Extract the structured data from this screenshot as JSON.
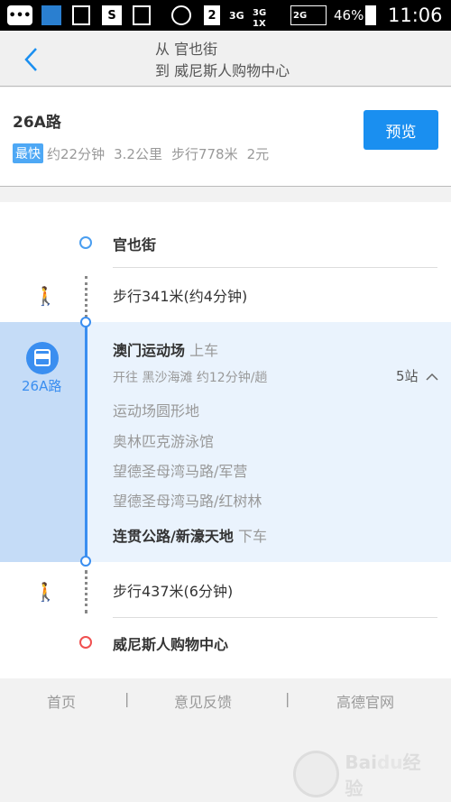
{
  "status_bar": {
    "sim": "2",
    "net1": "3G",
    "net2": "3G",
    "net3": "1X",
    "net4": "2G",
    "battery": "46%",
    "time": "11:06"
  },
  "header": {
    "from_prefix": "从",
    "from": "官也街",
    "to_prefix": "到",
    "to": "威尼斯人购物中心"
  },
  "route": {
    "name": "26A路",
    "badge": "最快",
    "duration": "约22分钟",
    "distance": "3.2公里",
    "walk": "步行778米",
    "fare": "2元",
    "preview_label": "预览"
  },
  "timeline": {
    "start": "官也街",
    "walk1": "步行341米(约4分钟)",
    "bus": {
      "line": "26A路",
      "board_stop": "澳门运动场",
      "board_label": "上车",
      "direction": "开往 黑沙海滩 约12分钟/趟",
      "stops_count": "5站",
      "stops": [
        "运动场圆形地",
        "奥林匹克游泳馆",
        "望德圣母湾马路/军营",
        "望德圣母湾马路/红树林"
      ],
      "alight_stop": "连贯公路/新濠天地",
      "alight_label": "下车"
    },
    "walk2": "步行437米(6分钟)",
    "end": "威尼斯人购物中心"
  },
  "footer": {
    "links": [
      "首页",
      "意见反馈",
      "高德官网"
    ],
    "separator": "|"
  },
  "watermark": "Baidu经验",
  "colors": {
    "accent": "#1a8ff0",
    "bus_bg": "#eaf3fd",
    "bus_side": "#c5dcf7",
    "start": "#4a9ef0",
    "end": "#f05050"
  }
}
